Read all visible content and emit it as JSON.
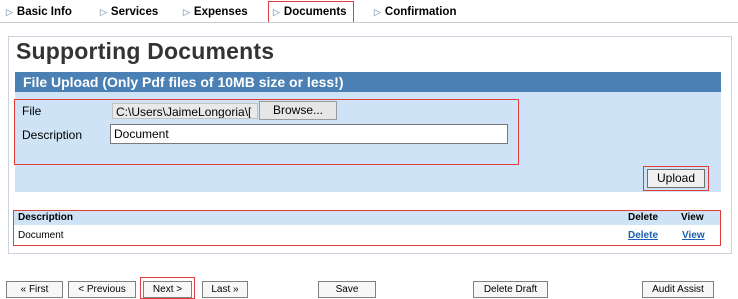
{
  "tabs": [
    {
      "label": "Basic Info",
      "active": false
    },
    {
      "label": "Services",
      "active": false
    },
    {
      "label": "Expenses",
      "active": false
    },
    {
      "label": "Documents",
      "active": true
    },
    {
      "label": "Confirmation",
      "active": false
    }
  ],
  "page_title": "Supporting Documents",
  "upload": {
    "header": "File Upload (Only Pdf files of 10MB size or less!)",
    "file_label": "File",
    "file_value": "C:\\Users\\JaimeLongoria\\[",
    "browse_label": "Browse...",
    "description_label": "Description",
    "description_value": "Document",
    "upload_label": "Upload"
  },
  "documents_table": {
    "headers": {
      "description": "Description",
      "delete": "Delete",
      "view": "View"
    },
    "rows": [
      {
        "description": "Document",
        "delete": "Delete",
        "view": "View"
      }
    ]
  },
  "footer_buttons": {
    "first": "« First",
    "previous": "< Previous",
    "next": "Next >",
    "last": "Last »",
    "save": "Save",
    "delete_draft": "Delete Draft",
    "audit_assist": "Audit Assist"
  },
  "colors": {
    "accent_red": "#e23d3d",
    "header_blue": "#4b80b5",
    "panel_blue": "#cfe3f6",
    "link_blue": "#1a5fb4"
  },
  "icons": {
    "tab_arrow": "triangle-right-icon"
  }
}
